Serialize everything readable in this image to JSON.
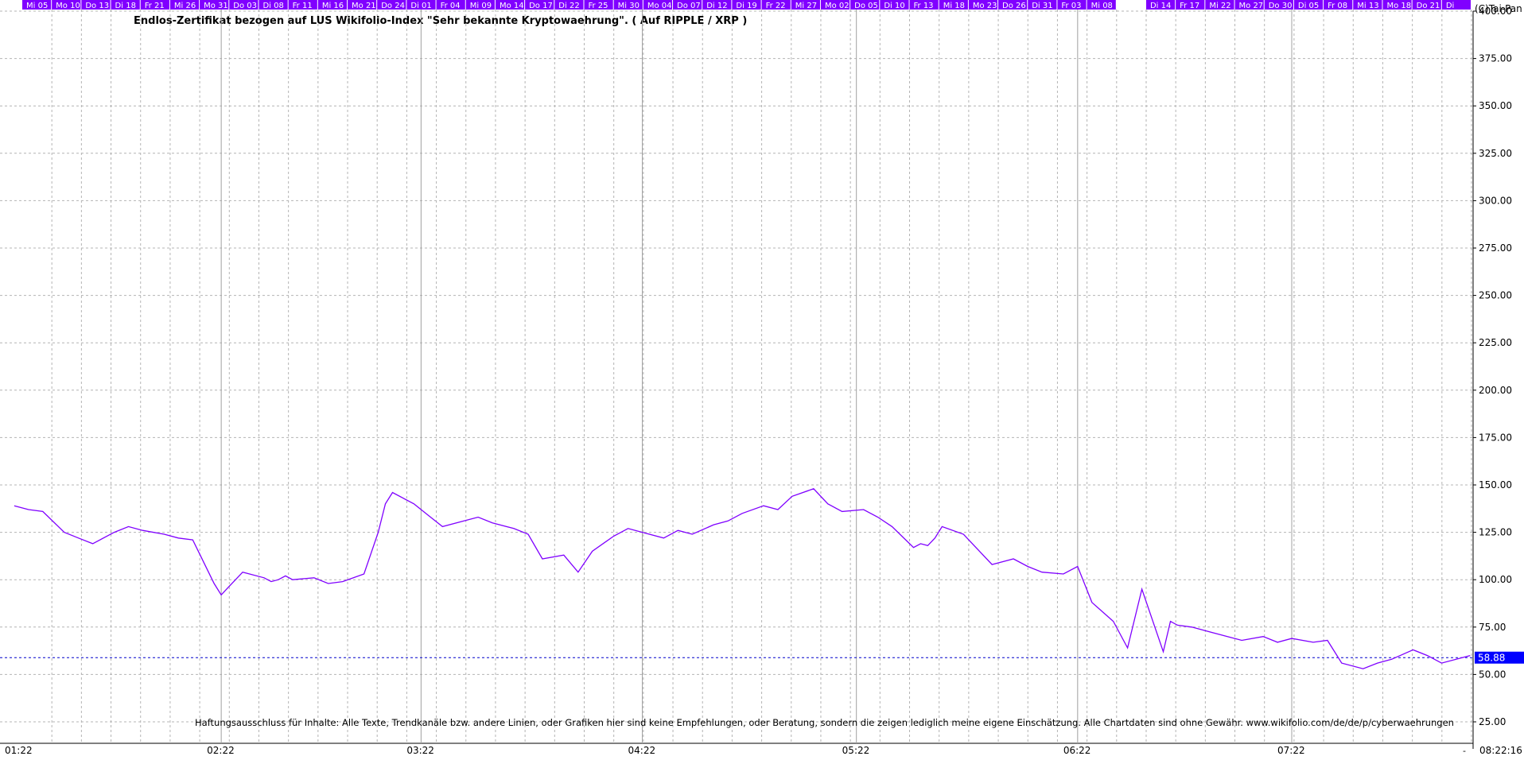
{
  "copyright": "(C)Tai-Pan",
  "timestamp": "08:22:16",
  "disclaimer": "Haftungsausschluss für Inhalte: Alle Texte, Trendkanäle bzw. andere Linien, oder Grafiken hier sind keine Empfehlungen, oder Beratung, sondern die zeigen lediglich meine eigene Einschätzung. Alle Chartdaten sind ohne Gewähr.  www.wikifolio.com/de/de/p/cyberwaehrungen",
  "colors": {
    "line": "#7f00ff",
    "day_strip": "#8000ff",
    "day_strip_text": "#ffffff",
    "grid": "#b4b4b4",
    "last_price_box": "#0000ff",
    "last_price_text": "#ffffff",
    "dotted_line": "#0000cc"
  },
  "chart_data": {
    "type": "line",
    "title": "Endlos-Zertifikat bezogen auf LUS Wikifolio-Index \"Sehr bekannte Kryptowaehrung\". ( Auf RIPPLE / XRP )",
    "xlabel": "",
    "ylabel": "",
    "ylim": [
      25,
      400
    ],
    "y_ticks": [
      "400.00",
      "375.00",
      "350.00",
      "325.00",
      "300.00",
      "275.00",
      "250.00",
      "225.00",
      "200.00",
      "175.00",
      "150.00",
      "125.00",
      "100.00",
      "75.00",
      "50.00",
      "25.00"
    ],
    "x_ticks": [
      "01:22",
      "02:22",
      "03:22",
      "04:22",
      "05:22",
      "06:22",
      "07:22"
    ],
    "day_labels": [
      "Mi 05",
      "Mo 10",
      "Do 13",
      "Di 18",
      "Fr 21",
      "Mi 26",
      "Mo 31",
      "Do 03",
      "Di 08",
      "Fr 11",
      "Mi 16",
      "Mo 21",
      "Do 24",
      "Di 01",
      "Fr 04",
      "Mi 09",
      "Mo 14",
      "Do 17",
      "Di 22",
      "Fr 25",
      "Mi 30",
      "Mo 04",
      "Do 07",
      "Di 12",
      "Di 19",
      "Fr 22",
      "Mi 27",
      "Mo 02",
      "Do 05",
      "Di 10",
      "Fr 13",
      "Mi 18",
      "Mo 23",
      "Do 26",
      "Di 31",
      "Fr 03",
      "Mi 08",
      "",
      "Di 14",
      "Fr 17",
      "Mi 22",
      "Mo 27",
      "Do 30",
      "Di 05",
      "Fr 08",
      "Mi 13",
      "Mo 18",
      "Do 21",
      "Di"
    ],
    "grid": true,
    "last_value": "58.88",
    "series": [
      {
        "x": [
          "2022-01-03",
          "2022-01-05",
          "2022-01-07",
          "2022-01-10",
          "2022-01-12",
          "2022-01-14",
          "2022-01-17",
          "2022-01-19",
          "2022-01-21",
          "2022-01-24",
          "2022-01-26",
          "2022-01-28",
          "2022-01-31",
          "2022-02-01",
          "2022-02-02",
          "2022-02-03",
          "2022-02-04",
          "2022-02-07",
          "2022-02-08",
          "2022-02-09",
          "2022-02-10",
          "2022-02-11",
          "2022-02-14",
          "2022-02-16",
          "2022-02-18",
          "2022-02-21",
          "2022-02-23",
          "2022-02-24",
          "2022-02-25",
          "2022-02-28",
          "2022-03-02",
          "2022-03-04",
          "2022-03-07",
          "2022-03-09",
          "2022-03-11",
          "2022-03-14",
          "2022-03-16",
          "2022-03-18",
          "2022-03-21",
          "2022-03-23",
          "2022-03-25",
          "2022-03-28",
          "2022-03-30",
          "2022-04-01",
          "2022-04-04",
          "2022-04-06",
          "2022-04-08",
          "2022-04-11",
          "2022-04-13",
          "2022-04-15",
          "2022-04-18",
          "2022-04-20",
          "2022-04-22",
          "2022-04-25",
          "2022-04-27",
          "2022-04-29",
          "2022-05-02",
          "2022-05-04",
          "2022-05-06",
          "2022-05-09",
          "2022-05-10",
          "2022-05-11",
          "2022-05-12",
          "2022-05-13",
          "2022-05-16",
          "2022-05-18",
          "2022-05-20",
          "2022-05-23",
          "2022-05-25",
          "2022-05-27",
          "2022-05-30",
          "2022-06-01",
          "2022-06-03",
          "2022-06-06",
          "2022-06-08",
          "2022-06-10",
          "2022-06-13",
          "2022-06-14",
          "2022-06-15",
          "2022-06-17",
          "2022-06-20",
          "2022-06-22",
          "2022-06-24",
          "2022-06-27",
          "2022-06-29",
          "2022-07-01",
          "2022-07-04",
          "2022-07-06",
          "2022-07-08",
          "2022-07-11",
          "2022-07-13",
          "2022-07-15",
          "2022-07-18",
          "2022-07-20",
          "2022-07-22",
          "2022-07-26"
        ],
        "values": [
          139,
          137,
          136,
          125,
          122,
          119,
          125,
          128,
          126,
          124,
          122,
          121,
          98,
          92,
          96,
          100,
          104,
          101,
          99,
          100,
          102,
          100,
          101,
          98,
          99,
          103,
          125,
          140,
          146,
          140,
          134,
          128,
          131,
          133,
          130,
          127,
          124,
          111,
          113,
          104,
          115,
          123,
          127,
          125,
          122,
          126,
          124,
          129,
          131,
          135,
          139,
          137,
          144,
          148,
          140,
          136,
          137,
          133,
          128,
          117,
          119,
          118,
          122,
          128,
          124,
          116,
          108,
          111,
          107,
          104,
          103,
          107,
          88,
          78,
          64,
          95,
          62,
          78,
          76,
          75,
          72,
          70,
          68,
          70,
          67,
          69,
          67,
          68,
          56,
          53,
          56,
          58,
          63,
          60,
          56,
          60
        ]
      }
    ]
  }
}
